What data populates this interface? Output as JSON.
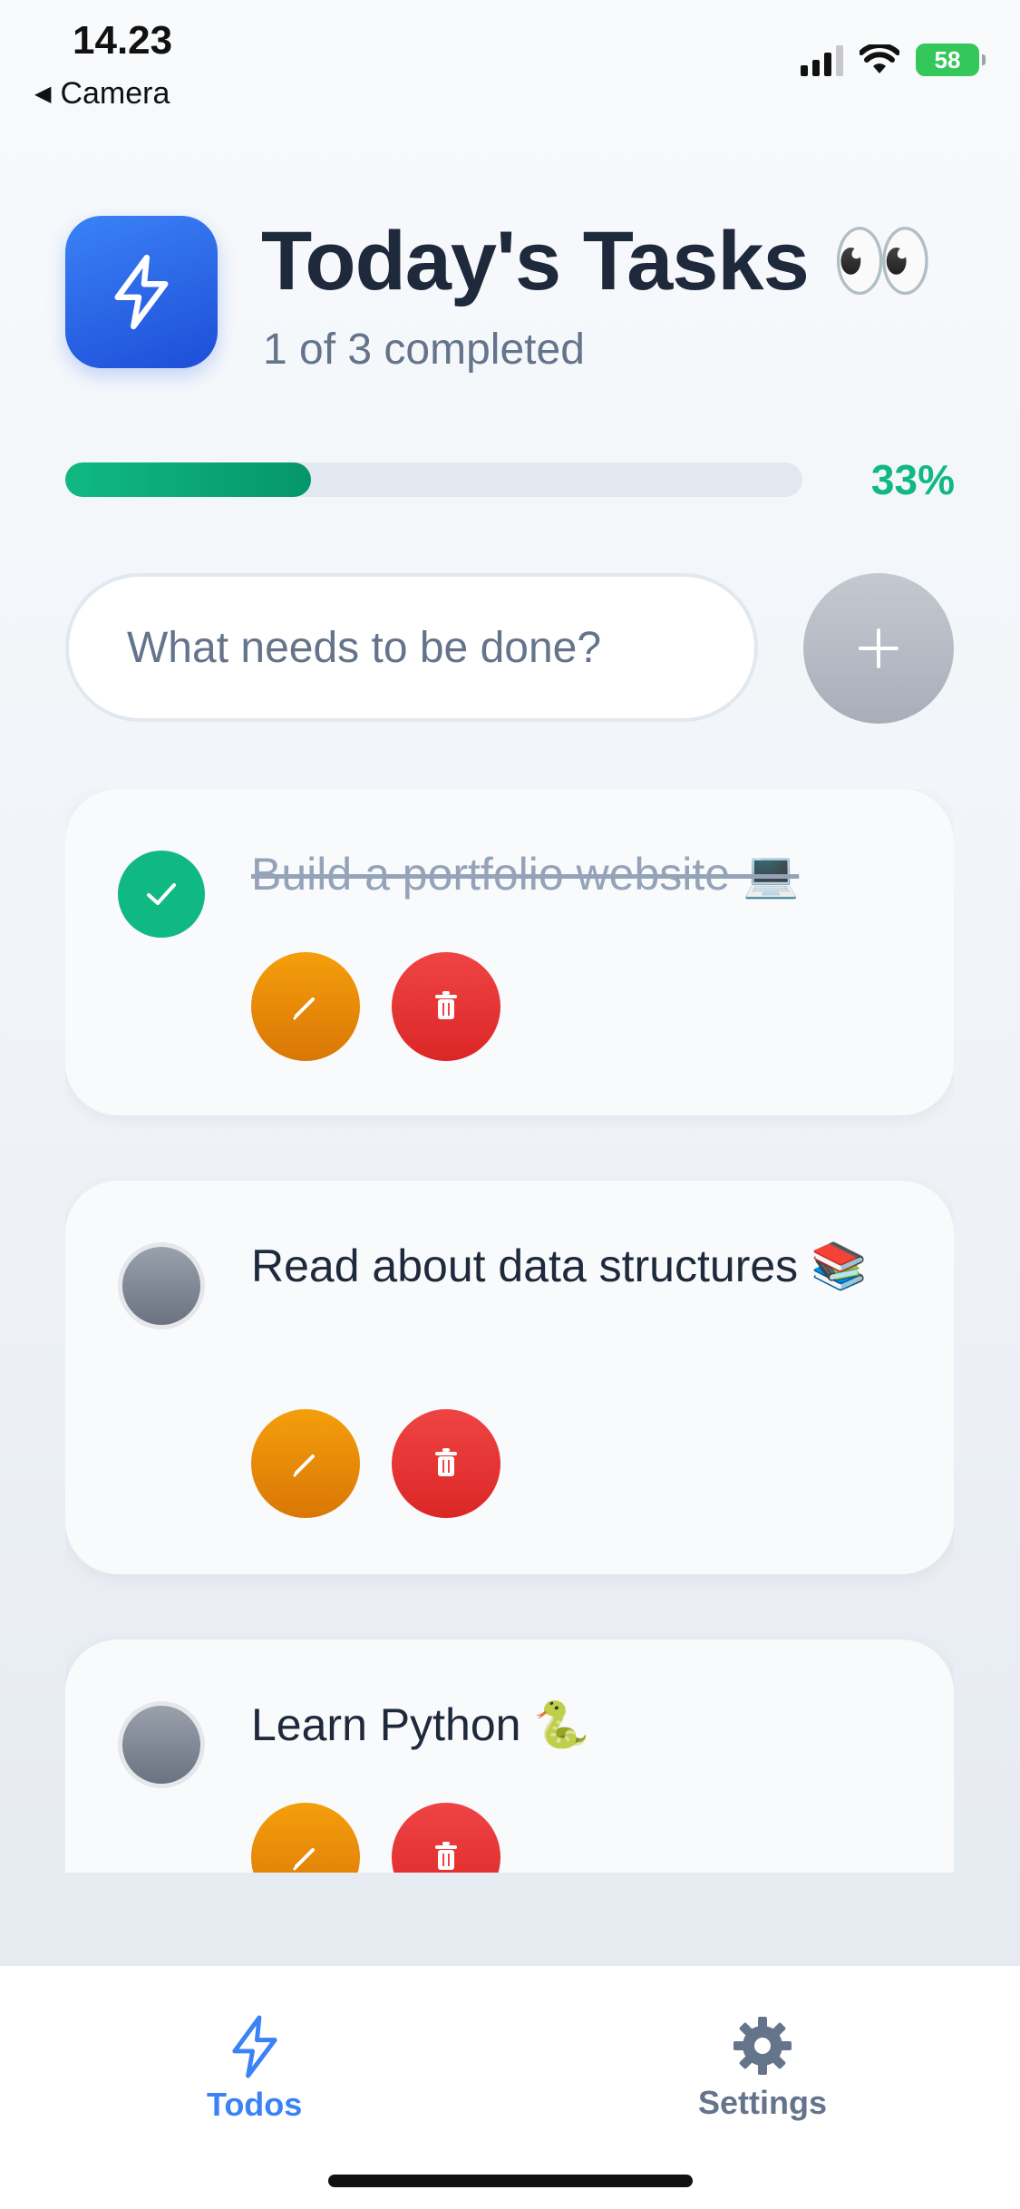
{
  "status_bar": {
    "time": "14.23",
    "back_label": "Camera",
    "battery": "58"
  },
  "header": {
    "title": "Today's Tasks 👀",
    "subtitle": "1 of 3 completed",
    "icon": "lightning-icon"
  },
  "progress": {
    "percent_label": "33%",
    "fraction": 0.333
  },
  "new_task": {
    "placeholder": "What needs to be done?",
    "add_icon": "plus-icon"
  },
  "tasks": [
    {
      "text": "Build a portfolio website 💻",
      "completed": true
    },
    {
      "text": "Read about data structures 📚",
      "completed": false
    },
    {
      "text": "Learn Python 🐍",
      "completed": false
    }
  ],
  "tabbar": {
    "todos_label": "Todos",
    "settings_label": "Settings"
  },
  "colors": {
    "accent": "#3b82f6",
    "success": "#10b981",
    "edit": "#f59e0b",
    "delete": "#ef4444"
  }
}
